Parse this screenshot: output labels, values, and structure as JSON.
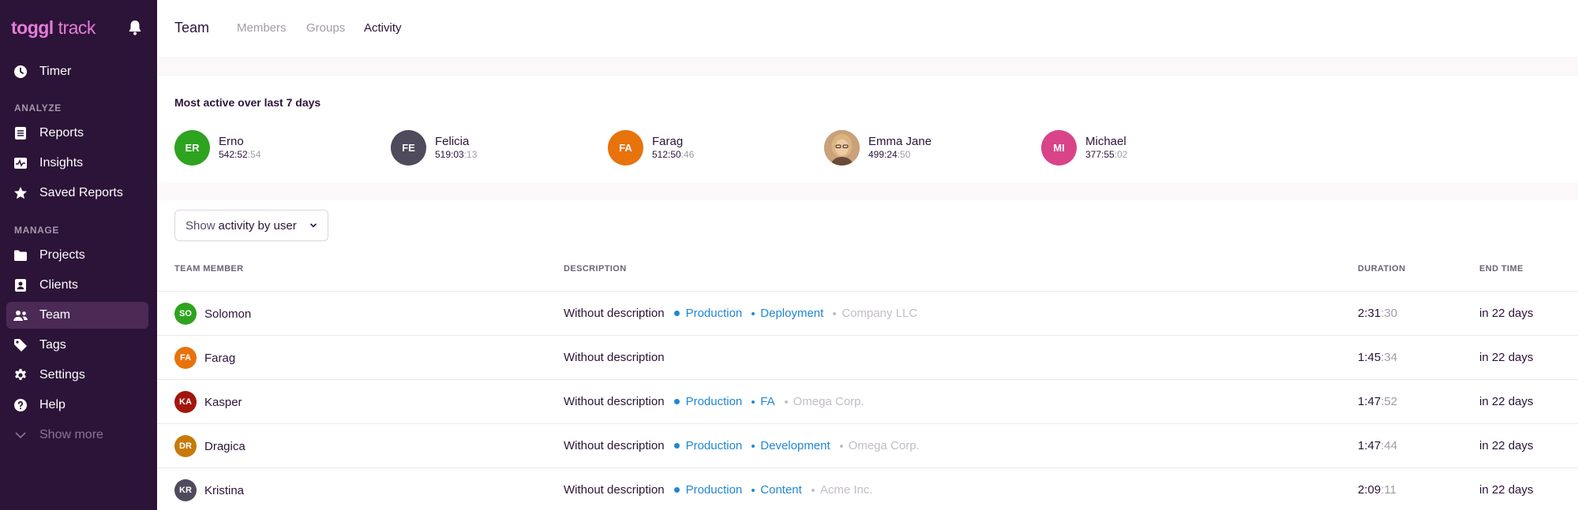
{
  "app": {
    "logo_bold": "toggl",
    "logo_light": " track"
  },
  "sidebar": {
    "timer": "Timer",
    "analyze_label": "ANALYZE",
    "reports": "Reports",
    "insights": "Insights",
    "saved_reports": "Saved Reports",
    "manage_label": "MANAGE",
    "projects": "Projects",
    "clients": "Clients",
    "team": "Team",
    "tags": "Tags",
    "settings": "Settings",
    "help": "Help",
    "show_more": "Show more"
  },
  "header": {
    "title": "Team",
    "tabs": [
      "Members",
      "Groups",
      "Activity"
    ],
    "active_tab": "Activity"
  },
  "most_active": {
    "title": "Most active over last 7 days",
    "people": [
      {
        "initials": "ER",
        "name": "Erno",
        "time": "542:52",
        "sec": ":54",
        "color": "#2ea31f"
      },
      {
        "initials": "FE",
        "name": "Felicia",
        "time": "519:03",
        "sec": ":13",
        "color": "#4f4a5c"
      },
      {
        "initials": "FA",
        "name": "Farag",
        "time": "512:50",
        "sec": ":46",
        "color": "#e8720c"
      },
      {
        "initials": "",
        "name": "Emma Jane",
        "time": "499:24",
        "sec": ":50",
        "color": "#b08968"
      },
      {
        "initials": "MI",
        "name": "Michael",
        "time": "377:55",
        "sec": ":02",
        "color": "#d94489"
      }
    ]
  },
  "filter": {
    "prefix": "Show",
    "value": "activity by user"
  },
  "table": {
    "headers": {
      "member": "TEAM MEMBER",
      "description": "DESCRIPTION",
      "duration": "DURATION",
      "end_time": "END TIME"
    },
    "rows": [
      {
        "initials": "SO",
        "name": "Solomon",
        "color": "#2ea31f",
        "description": "Without description",
        "project": "Production",
        "task": "Deployment",
        "client": "Company LLC",
        "dur": "2:31",
        "sec": ":30",
        "end": "in 22 days"
      },
      {
        "initials": "FA",
        "name": "Farag",
        "color": "#e8720c",
        "description": "Without description",
        "project": "",
        "task": "",
        "client": "",
        "dur": "1:45",
        "sec": ":34",
        "end": "in 22 days"
      },
      {
        "initials": "KA",
        "name": "Kasper",
        "color": "#a3160e",
        "description": "Without description",
        "project": "Production",
        "task": "FA",
        "client": "Omega Corp.",
        "dur": "1:47",
        "sec": ":52",
        "end": "in 22 days"
      },
      {
        "initials": "DR",
        "name": "Dragica",
        "color": "#c77a0b",
        "description": "Without description",
        "project": "Production",
        "task": "Development",
        "client": "Omega Corp.",
        "dur": "1:47",
        "sec": ":44",
        "end": "in 22 days"
      },
      {
        "initials": "KR",
        "name": "Kristina",
        "color": "#4f4a5c",
        "description": "Without description",
        "project": "Production",
        "task": "Content",
        "client": "Acme Inc.",
        "dur": "2:09",
        "sec": ":11",
        "end": "in 22 days"
      }
    ]
  },
  "colors": {
    "sidebar_bg": "#2c1338",
    "brand_pink": "#e57cd8",
    "project_blue": "#1f87d6"
  }
}
